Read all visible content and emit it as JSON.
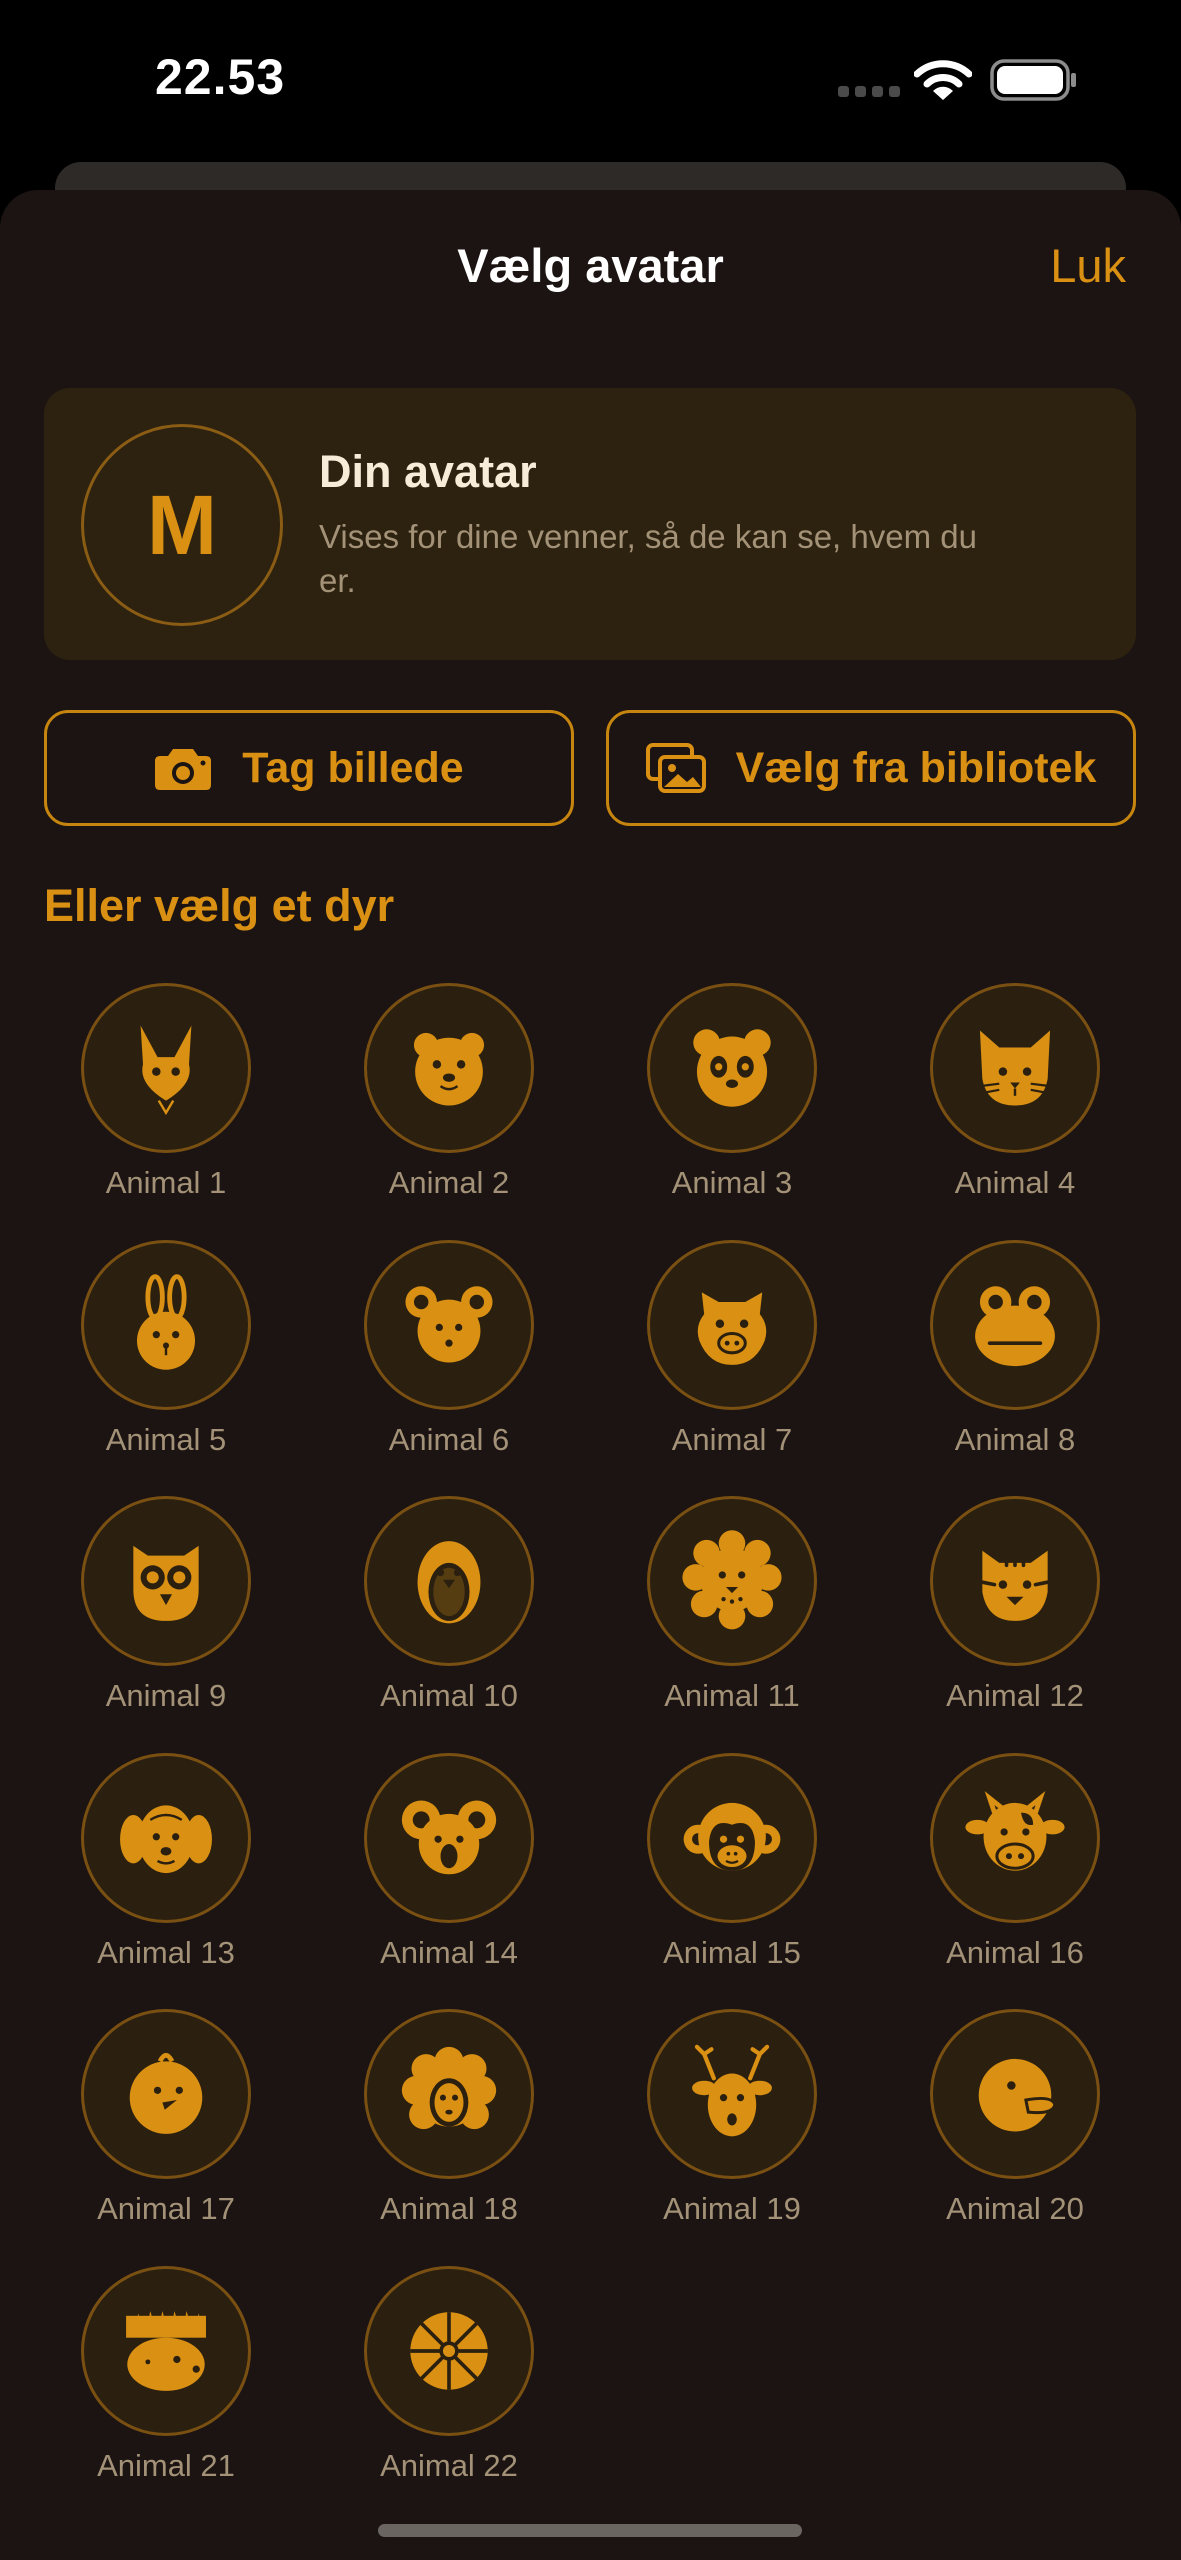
{
  "status": {
    "time": "22.53"
  },
  "sheet": {
    "title": "Vælg avatar",
    "close_label": "Luk"
  },
  "avatar_card": {
    "initial": "M",
    "title": "Din avatar",
    "description": "Vises for dine venner, så de kan se, hvem du er."
  },
  "actions": {
    "camera_label": "Tag billede",
    "library_label": "Vælg fra bibliotek"
  },
  "section": {
    "title": "Eller vælg et dyr"
  },
  "animals": [
    {
      "label": "Animal 1",
      "icon": "fox-icon"
    },
    {
      "label": "Animal 2",
      "icon": "bear-icon"
    },
    {
      "label": "Animal 3",
      "icon": "panda-icon"
    },
    {
      "label": "Animal 4",
      "icon": "cat-icon"
    },
    {
      "label": "Animal 5",
      "icon": "rabbit-icon"
    },
    {
      "label": "Animal 6",
      "icon": "mouse-icon"
    },
    {
      "label": "Animal 7",
      "icon": "pig-icon"
    },
    {
      "label": "Animal 8",
      "icon": "frog-icon"
    },
    {
      "label": "Animal 9",
      "icon": "owl-icon"
    },
    {
      "label": "Animal 10",
      "icon": "penguin-icon"
    },
    {
      "label": "Animal 11",
      "icon": "lion-icon"
    },
    {
      "label": "Animal 12",
      "icon": "tiger-icon"
    },
    {
      "label": "Animal 13",
      "icon": "dog-icon"
    },
    {
      "label": "Animal 14",
      "icon": "koala-icon"
    },
    {
      "label": "Animal 15",
      "icon": "monkey-icon"
    },
    {
      "label": "Animal 16",
      "icon": "cow-icon"
    },
    {
      "label": "Animal 17",
      "icon": "chick-icon"
    },
    {
      "label": "Animal 18",
      "icon": "sheep-icon"
    },
    {
      "label": "Animal 19",
      "icon": "deer-icon"
    },
    {
      "label": "Animal 20",
      "icon": "duck-icon"
    },
    {
      "label": "Animal 21",
      "icon": "hedgehog-icon"
    },
    {
      "label": "Animal 22",
      "icon": "turtle-icon"
    }
  ],
  "colors": {
    "accent": "#d99013",
    "sheet_bg": "#1b1412",
    "card_bg": "#2d2210"
  }
}
